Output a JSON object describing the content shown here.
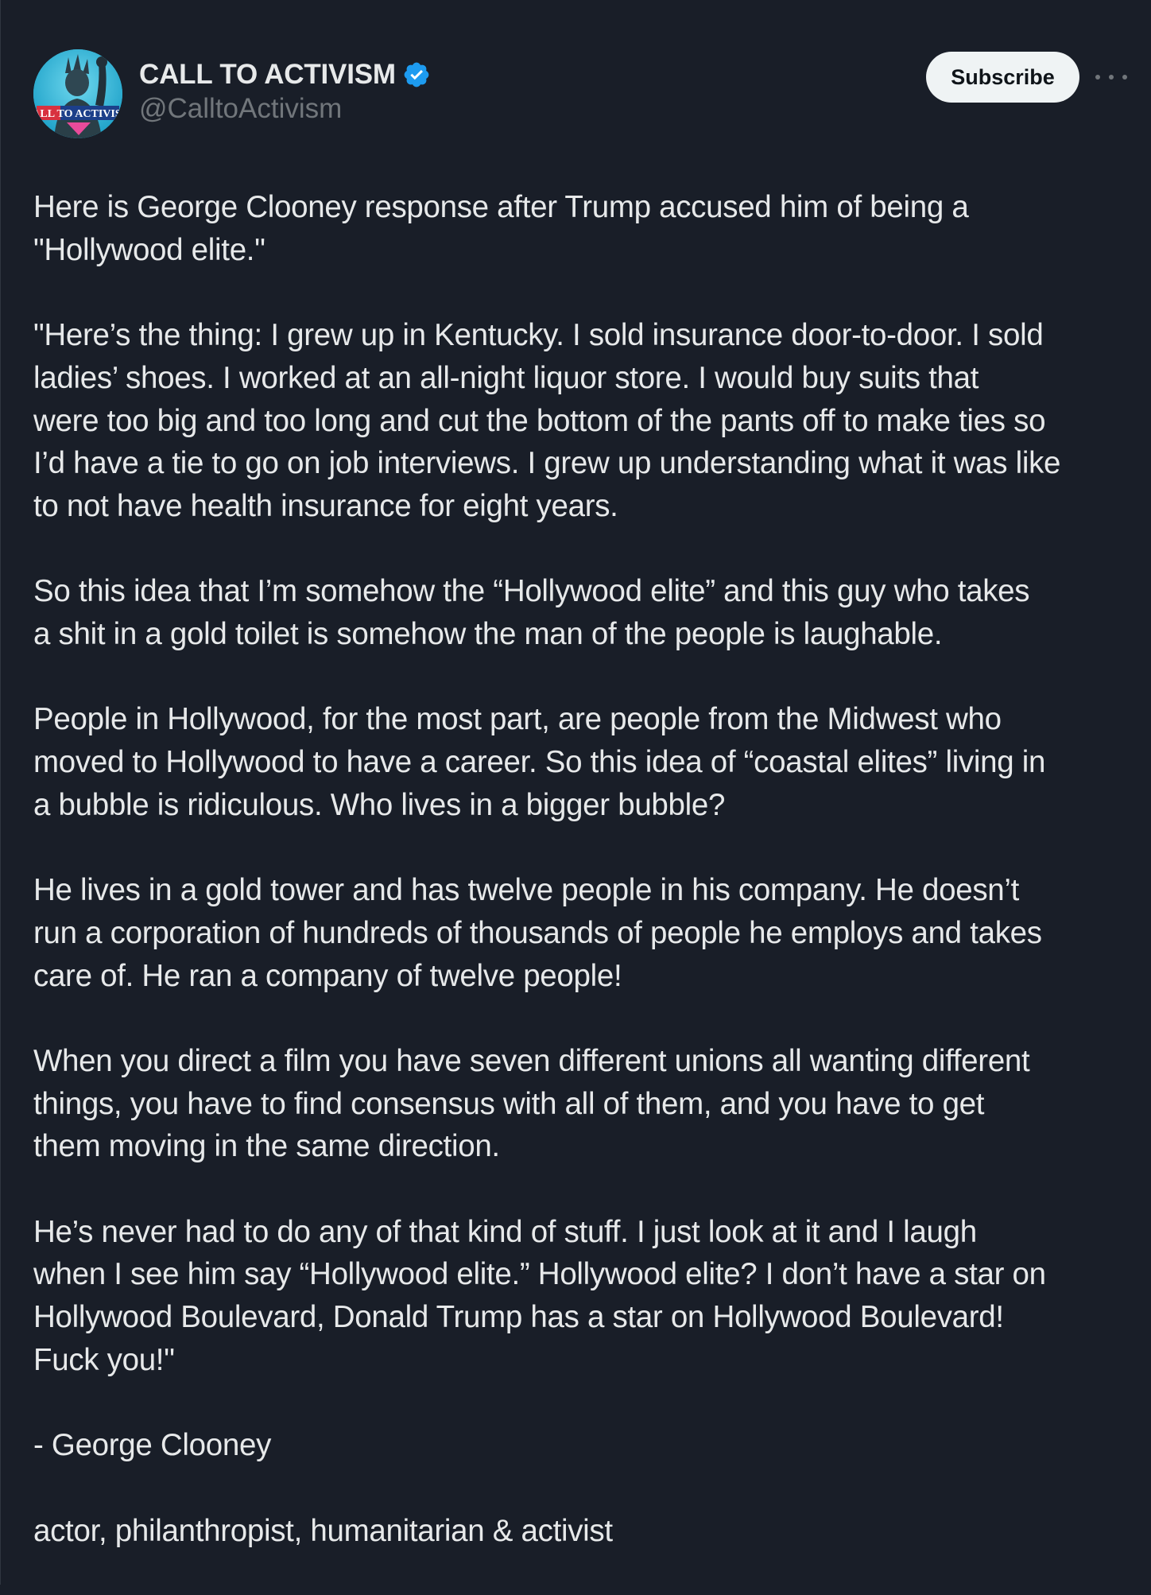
{
  "account": {
    "display_name": "CALL TO ACTIVISM",
    "handle": "@CalltoActivism",
    "avatar_text": "CALL TO ACTIVISM",
    "verified": true
  },
  "actions": {
    "subscribe_label": "Subscribe",
    "more_icon": "more-horizontal-icon"
  },
  "colors": {
    "background": "#191e28",
    "text": "#e7e9ea",
    "secondary": "#71767b",
    "verified": "#1d9bf0",
    "subscribe_bg": "#eff3f4"
  },
  "post": {
    "paragraphs": [
      {
        "lines": [
          "Here is George Clooney response after Trump accused him of being a",
          "\"Hollywood elite.\""
        ]
      },
      {
        "lines": [
          "\"Here’s the thing: I grew up in Kentucky. I sold insurance door-to-door. I sold",
          "ladies’ shoes. I worked at an all-night liquor store. I would buy suits that",
          "were too big and too long and cut the bottom of the pants off to make ties so",
          "I’d have a tie to go on job interviews. I grew up understanding what it was like",
          "to not have health insurance for eight years."
        ]
      },
      {
        "lines": [
          "So this idea that I’m somehow the “Hollywood elite” and this guy who takes",
          "a shit in a gold toilet is somehow the man of the people is laughable."
        ]
      },
      {
        "lines": [
          "People in Hollywood, for the most part, are people from the Midwest who",
          "moved to Hollywood to have a career. So this idea of “coastal elites” living in",
          "a bubble is ridiculous. Who lives in a bigger bubble?"
        ]
      },
      {
        "lines": [
          "He lives in a gold tower and has twelve people in his company. He doesn’t",
          "run a corporation of hundreds of thousands of people he employs and takes",
          "care of. He ran a company of twelve people!"
        ]
      },
      {
        "lines": [
          "When you direct a film you have seven different unions all wanting different",
          "things, you have to find consensus with all of them, and you have to get",
          "them moving in the same direction."
        ]
      },
      {
        "lines": [
          "He’s never had to do any of that kind of stuff. I just look at it and I laugh",
          "when I see him say “Hollywood elite.” Hollywood elite? I don’t have a star on",
          "Hollywood Boulevard, Donald Trump has a star on Hollywood Boulevard!",
          "Fuck you!\""
        ]
      },
      {
        "lines": [
          "- George Clooney"
        ]
      },
      {
        "lines": [
          "actor, philanthropist, humanitarian & activist"
        ]
      }
    ]
  }
}
